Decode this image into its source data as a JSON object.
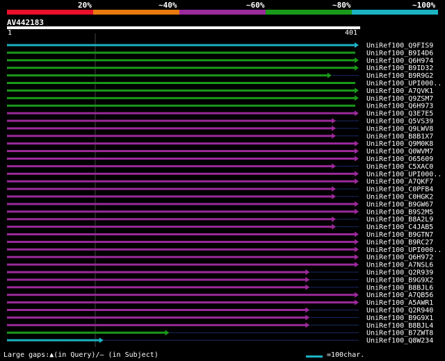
{
  "legend": {
    "labels": [
      "20%",
      "~40%",
      "~60%",
      "~80%",
      "~100%"
    ],
    "colors": [
      "#e8102a",
      "#e87a10",
      "#9b2a9b",
      "#1a9a1a",
      "#1bb3c4"
    ]
  },
  "query": {
    "name": "AV442183",
    "start_label": "1",
    "end_label": "401",
    "length": 401
  },
  "hits": [
    {
      "label": "UniRef100_Q9FIS9",
      "color_class": "~100%",
      "end": 401,
      "arrow": true
    },
    {
      "label": "UniRef100_B9I4D6",
      "color_class": "~80%",
      "end": 401,
      "arrow": false
    },
    {
      "label": "UniRef100_Q6H974",
      "color_class": "~80%",
      "end": 401,
      "arrow": true
    },
    {
      "label": "UniRef100_B9ID32",
      "color_class": "~80%",
      "end": 401,
      "arrow": true
    },
    {
      "label": "UniRef100_B9R9G2",
      "color_class": "~80%",
      "end": 370,
      "arrow": true
    },
    {
      "label": "UniRef100_UPI000..",
      "color_class": "~80%",
      "end": 401,
      "arrow": false
    },
    {
      "label": "UniRef100_A7QVK1",
      "color_class": "~80%",
      "end": 401,
      "arrow": true
    },
    {
      "label": "UniRef100_Q9ZSM7",
      "color_class": "~80%",
      "end": 401,
      "arrow": true
    },
    {
      "label": "UniRef100_Q6H973",
      "color_class": "~80%",
      "end": 401,
      "arrow": false
    },
    {
      "label": "UniRef100_Q3E7E5",
      "color_class": "~60%",
      "end": 401,
      "arrow": true
    },
    {
      "label": "UniRef100_Q5VS39",
      "color_class": "~60%",
      "end": 375,
      "arrow": true
    },
    {
      "label": "UniRef100_Q9LWV8",
      "color_class": "~60%",
      "end": 375,
      "arrow": true
    },
    {
      "label": "UniRef100_B8B1X7",
      "color_class": "~60%",
      "end": 375,
      "arrow": true
    },
    {
      "label": "UniRef100_Q9M0K8",
      "color_class": "~60%",
      "end": 401,
      "arrow": true
    },
    {
      "label": "UniRef100_Q0WVM7",
      "color_class": "~60%",
      "end": 401,
      "arrow": true
    },
    {
      "label": "UniRef100_O65609",
      "color_class": "~60%",
      "end": 401,
      "arrow": true
    },
    {
      "label": "UniRef100_C5XAC0",
      "color_class": "~60%",
      "end": 375,
      "arrow": true
    },
    {
      "label": "UniRef100_UPI000..",
      "color_class": "~60%",
      "end": 401,
      "arrow": true
    },
    {
      "label": "UniRef100_A7QKF7",
      "color_class": "~60%",
      "end": 401,
      "arrow": true
    },
    {
      "label": "UniRef100_C0PFB4",
      "color_class": "~60%",
      "end": 375,
      "arrow": true
    },
    {
      "label": "UniRef100_C0HGK2",
      "color_class": "~60%",
      "end": 375,
      "arrow": true
    },
    {
      "label": "UniRef100_B9GW67",
      "color_class": "~60%",
      "end": 401,
      "arrow": true
    },
    {
      "label": "UniRef100_B9S2M5",
      "color_class": "~60%",
      "end": 401,
      "arrow": true
    },
    {
      "label": "UniRef100_B8A2L9",
      "color_class": "~60%",
      "end": 375,
      "arrow": true
    },
    {
      "label": "UniRef100_C4JAB5",
      "color_class": "~60%",
      "end": 375,
      "arrow": true
    },
    {
      "label": "UniRef100_B9GTN7",
      "color_class": "~60%",
      "end": 401,
      "arrow": true
    },
    {
      "label": "UniRef100_B9RC27",
      "color_class": "~60%",
      "end": 401,
      "arrow": true
    },
    {
      "label": "UniRef100_UPI000..",
      "color_class": "~60%",
      "end": 401,
      "arrow": true
    },
    {
      "label": "UniRef100_Q6H972",
      "color_class": "~60%",
      "end": 401,
      "arrow": true
    },
    {
      "label": "UniRef100_A7NSL6",
      "color_class": "~60%",
      "end": 401,
      "arrow": true
    },
    {
      "label": "UniRef100_Q2R939",
      "color_class": "~60%",
      "end": 345,
      "arrow": true
    },
    {
      "label": "UniRef100_B9G9X2",
      "color_class": "~60%",
      "end": 345,
      "arrow": true
    },
    {
      "label": "UniRef100_B8BJL6",
      "color_class": "~60%",
      "end": 345,
      "arrow": true
    },
    {
      "label": "UniRef100_A7QB56",
      "color_class": "~60%",
      "end": 401,
      "arrow": true
    },
    {
      "label": "UniRef100_A5AWR1",
      "color_class": "~60%",
      "end": 401,
      "arrow": true
    },
    {
      "label": "UniRef100_Q2R940",
      "color_class": "~60%",
      "end": 345,
      "arrow": true
    },
    {
      "label": "UniRef100_B9G9X1",
      "color_class": "~60%",
      "end": 345,
      "arrow": true
    },
    {
      "label": "UniRef100_B8BJL4",
      "color_class": "~60%",
      "end": 345,
      "arrow": true
    },
    {
      "label": "UniRef100_B7ZWT8",
      "color_class": "~80%",
      "end": 185,
      "arrow": true
    },
    {
      "label": "UniRef100_Q8W234",
      "color_class": "~100%",
      "end": 110,
      "arrow": true
    }
  ],
  "footer": {
    "gaps_text": "Large gaps:▲(in Query)/— (in Subject)",
    "scale_text": "=100char."
  }
}
